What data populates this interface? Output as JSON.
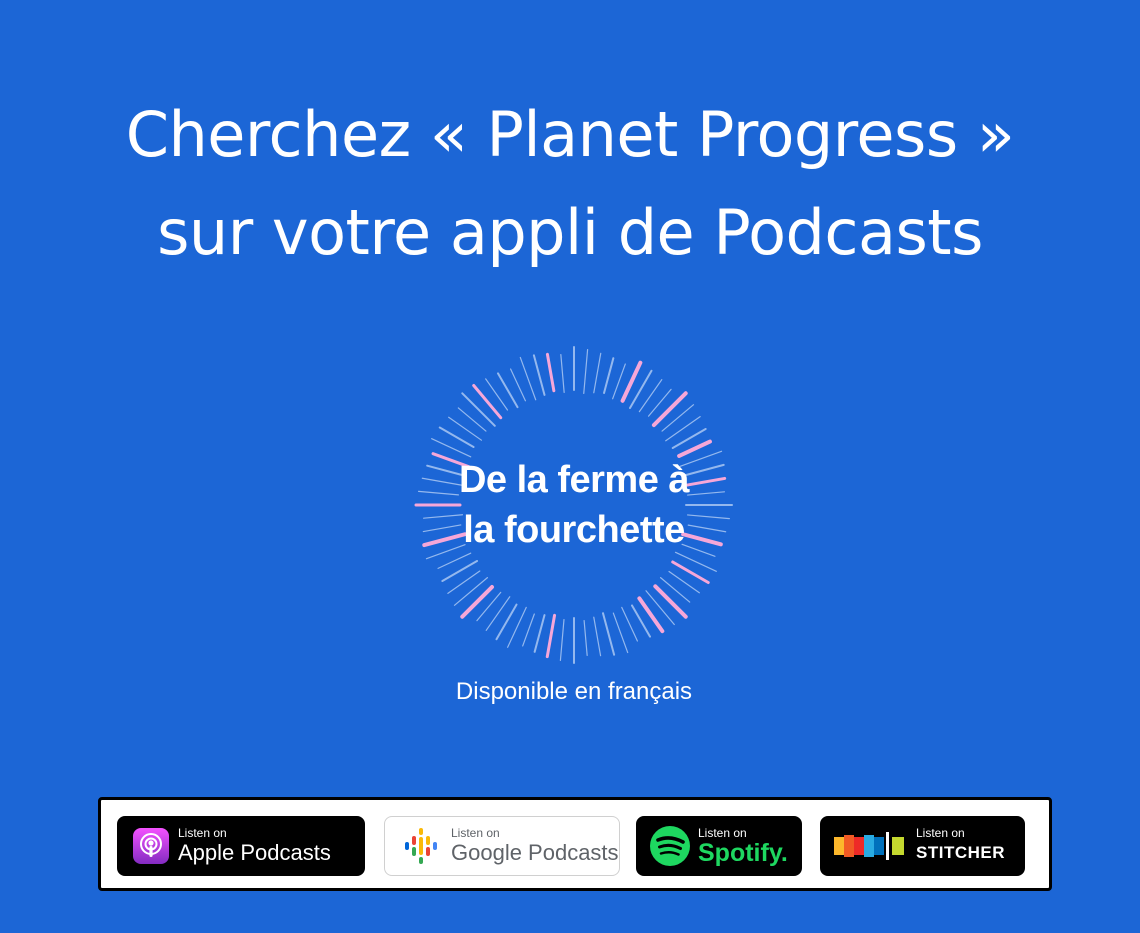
{
  "headline": {
    "line1": "Cherchez « Planet Progress »",
    "line2": "sur votre appli de Podcasts"
  },
  "show": {
    "title_line1": "De la ferme à",
    "title_line2": "la fourchette",
    "subtitle": "Disponible en français"
  },
  "badges": [
    {
      "small": "Listen on",
      "big": "Apple Podcasts",
      "icon": "apple-podcasts-icon"
    },
    {
      "small": "Listen on",
      "big": "Google Podcasts",
      "icon": "google-podcasts-icon"
    },
    {
      "small": "Listen on",
      "big": "Spotify.",
      "icon": "spotify-icon"
    },
    {
      "small": "Listen on",
      "big": "STITCHER",
      "icon": "stitcher-icon"
    }
  ],
  "colors": {
    "background": "#1c66d6",
    "burst_light": "#a9c7f3",
    "burst_pink": "#f6a7d8",
    "spotify_green": "#1ed760"
  }
}
